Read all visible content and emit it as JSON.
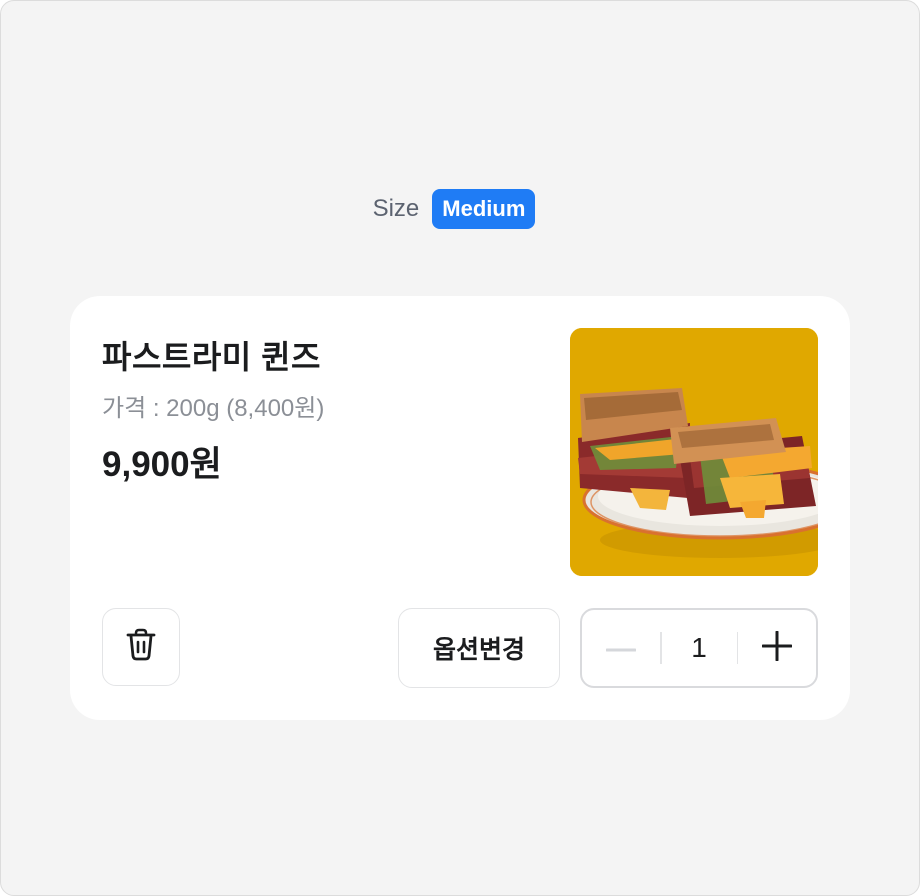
{
  "size_selector": {
    "label": "Size",
    "value": "Medium",
    "accent_color": "#1f7cf5"
  },
  "product": {
    "name": "파스트라미 퀸즈",
    "weight_price": "가격 : 200g (8,400원)",
    "price": "9,900원",
    "image_description": "pastrami-cheese-sandwich-photo"
  },
  "actions": {
    "delete_icon": "trash-icon",
    "option_change_label": "옵션변경"
  },
  "quantity": {
    "decrement_icon": "minus-icon",
    "value": "1",
    "increment_icon": "plus-icon"
  }
}
